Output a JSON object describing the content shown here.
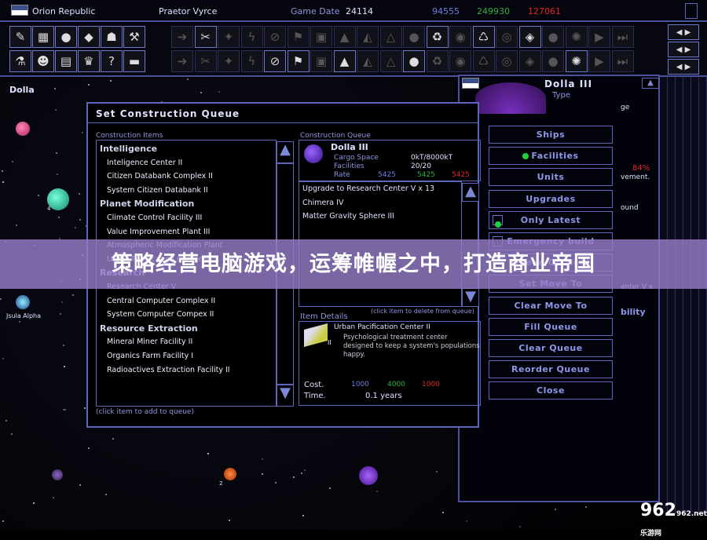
{
  "topbar": {
    "empire": "Orion Republic",
    "leader": "Praetor Vyrce",
    "game_date_label": "Game Date",
    "game_date": "24114",
    "minerals": "94555",
    "organics": "249930",
    "radioactives": "127061"
  },
  "map": {
    "system_name": "Dolla",
    "star_label": "Jsula Alpha",
    "planet_number": "4",
    "planet_number2": "2"
  },
  "dialog": {
    "title": "Set Construction Queue",
    "items_label": "Construction Items",
    "categories": [
      {
        "name": "Intelligence",
        "items": [
          "Inteligence Center II",
          "Citizen Databank Complex II",
          "System Citizen Databank II"
        ]
      },
      {
        "name": "Planet Modification",
        "items": [
          "Climate Control Facility III",
          "Value Improvement Plant III",
          "Atmospheric Modification Plant",
          "Urban Pacification Center III"
        ]
      },
      {
        "name": "Research",
        "items": [
          "Research Center V",
          "Central Computer Complex II",
          "System Computer Compex II"
        ]
      },
      {
        "name": "Resource Extraction",
        "items": [
          "Mineral Miner Facility II",
          "Organics Farm Facility I",
          "Radioactives Extraction Facility II"
        ]
      }
    ],
    "items_hint": "(click item to add to queue)",
    "queue_label": "Construction Queue",
    "planet": "Dolla III",
    "cargo_label": "Cargo Space",
    "cargo": "0kT/8000kT",
    "facilities_label": "Facilities",
    "facilities": "20/20",
    "rate_label": "Rate",
    "rate_min": "5425",
    "rate_org": "5425",
    "rate_rad": "5425",
    "queue": [
      "Upgrade to Research Center V x 13",
      "Chimera IV",
      "Matter Gravity Sphere III"
    ],
    "queue_hint": "(click item to delete from queue)",
    "details_label": "Item Details",
    "detail_name": "Urban Pacification Center II",
    "detail_level": "II",
    "detail_desc": "Psychological treatment center designed to keep a system's populations happy.",
    "cost_label": "Cost.",
    "cost_min": "1000",
    "cost_org": "4000",
    "cost_rad": "1000",
    "time_label": "Time.",
    "time": "0.1 years"
  },
  "buttons": [
    "Ships",
    "Facilities",
    "Units",
    "Upgrades",
    "Only Latest",
    "Emergency build",
    "Queue On Hold",
    "Set Move To",
    "Clear Move To",
    "Fill Queue",
    "Clear Queue",
    "Reorder Queue",
    "Close"
  ],
  "rightpanel": {
    "planet": "Dolla III",
    "type_label": "Type",
    "frag1": "ge",
    "percent": "84%",
    "frag2": "vement.",
    "frag3": "ound",
    "frag4": "enter V x",
    "frag5": "bility"
  },
  "banner": "策略经营电脑游戏，运筹帷幄之中，打造商业帝国",
  "watermark": "962.net 乐游网",
  "colors": {
    "frame": "#5d66b8",
    "minerals": "#6f7fe0",
    "organics": "#2fb040",
    "radioactives": "#e02828",
    "banner": "#967dc8"
  }
}
